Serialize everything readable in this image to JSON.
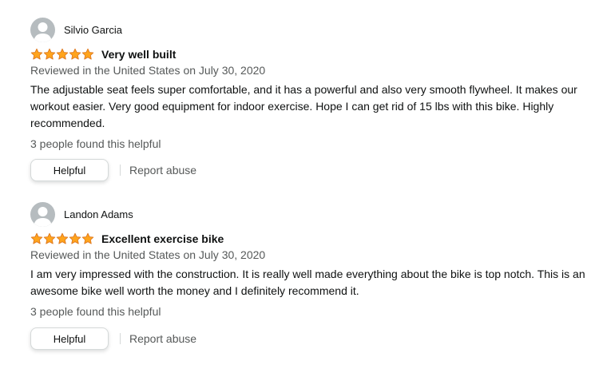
{
  "colors": {
    "star": "#ffa41c",
    "star_outline": "#de7921",
    "avatar_bg": "#b6bcbf",
    "text_primary": "#0f1111",
    "text_secondary": "#565959",
    "button_border": "#d5d9d9"
  },
  "reviews": [
    {
      "reviewer": "Silvio Garcia",
      "avatar_icon": "user-avatar-icon",
      "rating": 5,
      "rating_max": 5,
      "title": "Very well built",
      "date": "Reviewed in the United States on July 30, 2020",
      "body": "The adjustable seat feels super comfortable, and it has a powerful and also very smooth flywheel. It makes our workout easier. Very good equipment for indoor exercise. Hope I can get rid of 15 lbs with this bike. Highly recommended.",
      "helpful_count": "3 people found this helpful",
      "helpful_label": "Helpful",
      "report_label": "Report abuse"
    },
    {
      "reviewer": "Landon Adams",
      "avatar_icon": "user-avatar-icon",
      "rating": 5,
      "rating_max": 5,
      "title": "Excellent exercise bike",
      "date": "Reviewed in the United States on July 30, 2020",
      "body": "I am very impressed with the construction. It is really well made everything about the bike is top notch. This is an awesome bike well worth the money and I definitely recommend it.",
      "helpful_count": "3 people found this helpful",
      "helpful_label": "Helpful",
      "report_label": "Report abuse"
    }
  ]
}
